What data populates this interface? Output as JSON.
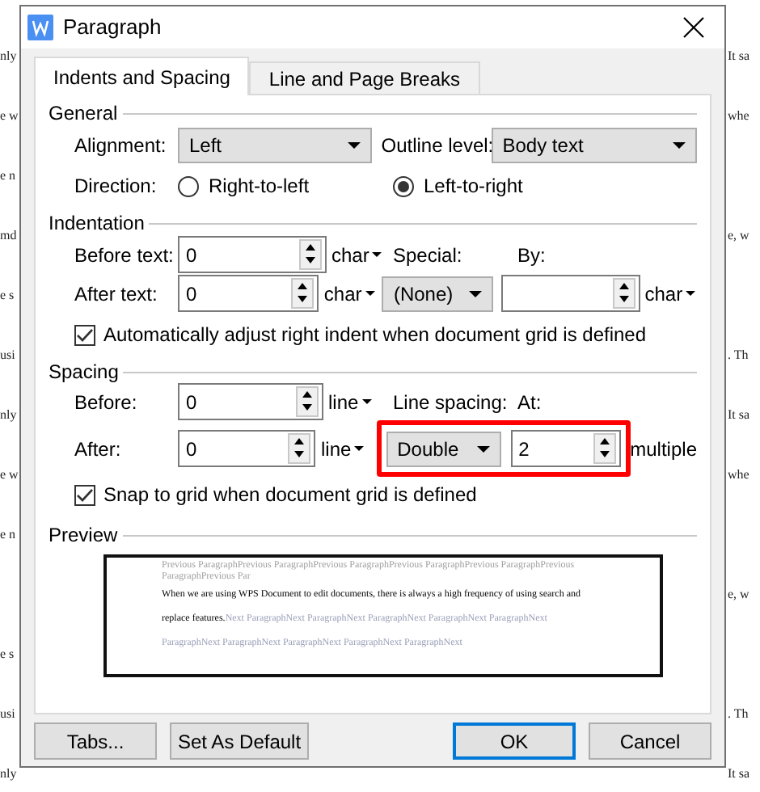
{
  "background_lines": [
    {
      "left": "nly",
      "right": "It sa"
    },
    {
      "left": "e w",
      "right": "whe"
    },
    {
      "left": "e n"
    },
    {
      "left": "md",
      "right": "e, w"
    },
    {
      "left": "e s"
    },
    {
      "left": "usi",
      "right": ". Th"
    },
    {
      "left": "nly",
      "right": "It sa"
    },
    {
      "left": "e w",
      "right": "whe"
    },
    {
      "left": "e n"
    },
    {
      "right": "e, w"
    },
    {
      "left": "e s"
    },
    {
      "left": "usi",
      "right": ". Th"
    },
    {
      "left": "nly",
      "right": "It sa"
    }
  ],
  "dialog": {
    "title": "Paragraph",
    "tabs": [
      {
        "label": "Indents and Spacing",
        "selected": true
      },
      {
        "label": "Line and Page Breaks",
        "selected": false
      }
    ],
    "general": {
      "heading": "General",
      "alignment": {
        "label": "Alignment:",
        "value": "Left"
      },
      "outline_level": {
        "label": "Outline level:",
        "value": "Body text"
      },
      "direction": {
        "label": "Direction:",
        "options": [
          {
            "label": "Right-to-left",
            "selected": false
          },
          {
            "label": "Left-to-right",
            "selected": true
          }
        ]
      }
    },
    "indentation": {
      "heading": "Indentation",
      "before_text": {
        "label": "Before text:",
        "value": "0",
        "unit": "char"
      },
      "after_text": {
        "label": "After text:",
        "value": "0",
        "unit": "char"
      },
      "special": {
        "label": "Special:",
        "value": "(None)"
      },
      "by": {
        "label": "By:",
        "unit": "char"
      },
      "auto_adjust": {
        "label": "Automatically adjust right indent when document grid is defined",
        "checked": true
      }
    },
    "spacing": {
      "heading": "Spacing",
      "before": {
        "label": "Before:",
        "value": "0",
        "unit": "line"
      },
      "after": {
        "label": "After:",
        "value": "0",
        "unit": "line"
      },
      "line_spacing": {
        "label": "Line spacing:",
        "value": "Double",
        "highlighted": true
      },
      "at": {
        "label": "At:",
        "value": "2",
        "unit": "multiple"
      },
      "snap_to_grid": {
        "label": "Snap to grid when document grid is defined",
        "checked": true
      }
    },
    "preview": {
      "heading": "Preview",
      "segments": [
        {
          "kind": "previous",
          "text": "Previous ParagraphPrevious ParagraphPrevious ParagraphPrevious ParagraphPrevious ParagraphPrevious ParagraphPrevious Par"
        },
        {
          "kind": "current",
          "text": "When we are using WPS Document to edit documents, there is always a high frequency of using search and replace features."
        },
        {
          "kind": "next",
          "text": "Next ParagraphNext ParagraphNext ParagraphNext ParagraphNext ParagraphNext ParagraphNext ParagraphNext ParagraphNext ParagraphNext ParagraphNext"
        }
      ]
    },
    "buttons": [
      {
        "label": "Tabs...",
        "default": false
      },
      {
        "label": "Set As Default",
        "default": false
      },
      {
        "label": "OK",
        "default": true
      },
      {
        "label": "Cancel",
        "default": false
      }
    ]
  }
}
